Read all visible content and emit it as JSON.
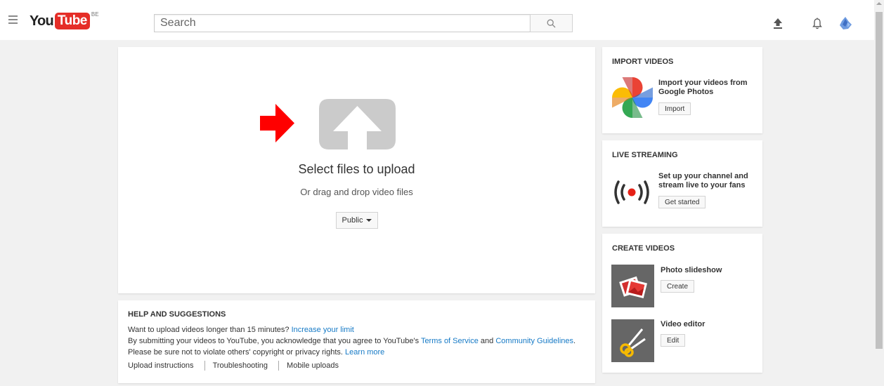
{
  "header": {
    "logo_you": "You",
    "logo_tube": "Tube",
    "country_code": "BE",
    "search_placeholder": "Search",
    "icons": [
      "menu-icon",
      "search-icon",
      "upload-icon",
      "bell-icon",
      "avatar"
    ]
  },
  "upload": {
    "title": "Select files to upload",
    "subtitle": "Or drag and drop video files",
    "privacy_label": "Public",
    "accent_color": "#ff0000"
  },
  "help": {
    "heading": "HELP AND SUGGESTIONS",
    "line1_text": "Want to upload videos longer than 15 minutes?",
    "line1_link": "Increase your limit",
    "line2_text_a": "By submitting your videos to YouTube, you acknowledge that you agree to YouTube's",
    "line2_link_a": "Terms of Service",
    "line2_and": "and",
    "line2_link_b": "Community Guidelines",
    "line2_end": ".",
    "line3_text": "Please be sure not to violate others' copyright or privacy rights.",
    "line3_link": "Learn more",
    "links": [
      "Upload instructions",
      "Troubleshooting",
      "Mobile uploads"
    ]
  },
  "import_card": {
    "heading": "IMPORT VIDEOS",
    "desc": "Import your videos from Google Photos",
    "button": "Import"
  },
  "live_card": {
    "heading": "LIVE STREAMING",
    "desc": "Set up your channel and stream live to your fans",
    "button": "Get started"
  },
  "create_card": {
    "heading": "CREATE VIDEOS",
    "items": [
      {
        "title": "Photo slideshow",
        "button": "Create"
      },
      {
        "title": "Video editor",
        "button": "Edit"
      }
    ]
  }
}
